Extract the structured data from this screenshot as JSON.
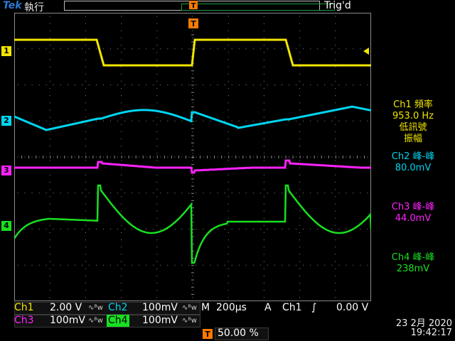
{
  "header": {
    "brand": "Tek",
    "run_state": "執行",
    "trigger_state": "Trig'd",
    "trigger_position_marker": "T"
  },
  "channel_markers": [
    "1",
    "2",
    "3",
    "4"
  ],
  "measurements": {
    "ch1_title": "Ch1 頻率",
    "ch1_value": "953.0 Hz",
    "ch1_note1": "低訊號",
    "ch1_note2": "振幅",
    "ch2_title": "Ch2 峰-峰",
    "ch2_value": "80.0mV",
    "ch3_title": "Ch3 峰-峰",
    "ch3_value": "44.0mV",
    "ch4_title": "Ch4 峰-峰",
    "ch4_value": "238mV"
  },
  "status": {
    "ch1_label": "Ch1",
    "ch1_scale": "2.00 V",
    "ch2_label": "Ch2",
    "ch2_scale": "100mV",
    "ch3_label": "Ch3",
    "ch3_scale": "100mV",
    "ch4_label": "Ch4",
    "ch4_scale": "100mV",
    "bw_symbol": "∿ᴮw",
    "timebase_label": "M",
    "timebase_value": "200µs",
    "trigger_mode": "A",
    "trigger_source": "Ch1",
    "trigger_slope": "∫",
    "trigger_level": "0.00 V",
    "trigger_pos_marker": "T",
    "trigger_pos_value": "50.00 %",
    "date": "23 2月  2020",
    "time": "19:42:17"
  },
  "colors": {
    "ch1": "#f2e600",
    "ch2": "#00d6f0",
    "ch3": "#ff22ff",
    "ch4": "#18e020",
    "trigger": "#ff7a00",
    "graticule": "#8a8a8a"
  }
}
